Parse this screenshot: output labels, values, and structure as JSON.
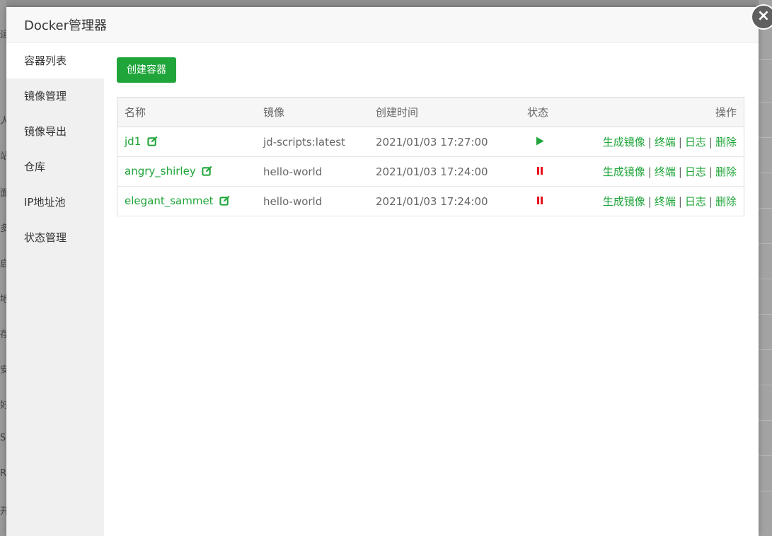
{
  "dialog": {
    "title": "Docker管理器",
    "close_symbol": "×"
  },
  "sidebar": {
    "items": [
      {
        "label": "容器列表",
        "active": true
      },
      {
        "label": "镜像管理"
      },
      {
        "label": "镜像导出"
      },
      {
        "label": "仓库"
      },
      {
        "label": "IP地址池"
      },
      {
        "label": "状态管理"
      }
    ]
  },
  "toolbar": {
    "create_label": "创建容器"
  },
  "table": {
    "headers": {
      "name": "名称",
      "image": "镜像",
      "created": "创建时间",
      "status": "状态",
      "ops": "操作"
    },
    "rows": [
      {
        "name": "jd1",
        "image": "jd-scripts:latest",
        "created": "2021/01/03 17:27:00",
        "status": "running"
      },
      {
        "name": "angry_shirley",
        "image": "hello-world",
        "created": "2021/01/03 17:24:00",
        "status": "stopped"
      },
      {
        "name": "elegant_sammet",
        "image": "hello-world",
        "created": "2021/01/03 17:24:00",
        "status": "stopped"
      }
    ],
    "actions": {
      "make_image": "生成镜像",
      "terminal": "终端",
      "log": "日志",
      "delete": "删除",
      "separator": "|"
    }
  },
  "background": {
    "stubs": [
      "运",
      "人",
      "站",
      "面",
      "多",
      "启",
      "地",
      "存",
      "安",
      "好",
      "S",
      "R",
      "开"
    ]
  },
  "colors": {
    "accent": "#20a53a",
    "stop": "#e8101c",
    "header_bg": "#f8f8f8",
    "sidebar_bg": "#f0f0f0",
    "overlay": "#8f8f8f"
  },
  "icons": {
    "edit": "edit-icon",
    "running": "play-icon",
    "stopped": "pause-icon",
    "close": "close-icon"
  }
}
